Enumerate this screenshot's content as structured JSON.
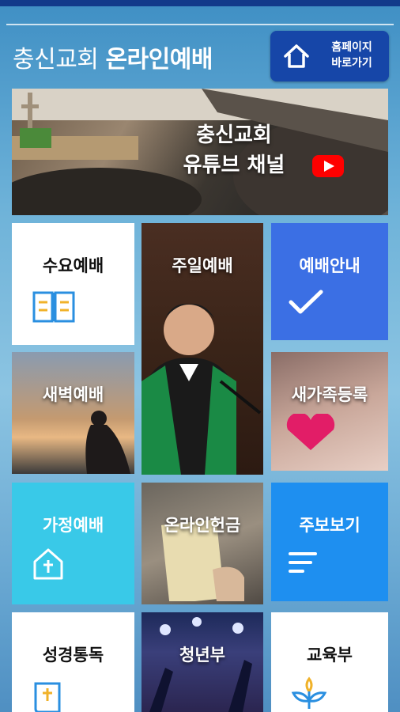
{
  "header": {
    "title_regular": "충신교회",
    "title_bold": "온라인예배",
    "home_button_line1": "홈페이지",
    "home_button_line2": "바로가기"
  },
  "banner": {
    "line1": "충신교회",
    "line2": "유튜브 채널"
  },
  "tiles": {
    "wednesday": "수요예배",
    "sunday": "주일예배",
    "guide": "예배안내",
    "dawn": "새벽예배",
    "newfamily": "새가족등록",
    "family": "가정예배",
    "offering": "온라인헌금",
    "bulletin": "주보보기",
    "bible": "성경통독",
    "youth": "청년부",
    "education": "교육부"
  },
  "colors": {
    "header_bar": "#123a8a",
    "home_button": "#1646a8",
    "tile_blue": "#3b6fe4",
    "tile_cyan": "#39c9e8",
    "tile_bright_blue": "#1e8ff0",
    "icon_accent": "#2a8fe0",
    "youtube_red": "#ff0000"
  },
  "icons": [
    "home-icon",
    "youtube-play-icon",
    "open-book-icon",
    "checkmark-icon",
    "house-cross-icon",
    "menu-lines-icon",
    "bible-icon",
    "sprout-icon"
  ]
}
